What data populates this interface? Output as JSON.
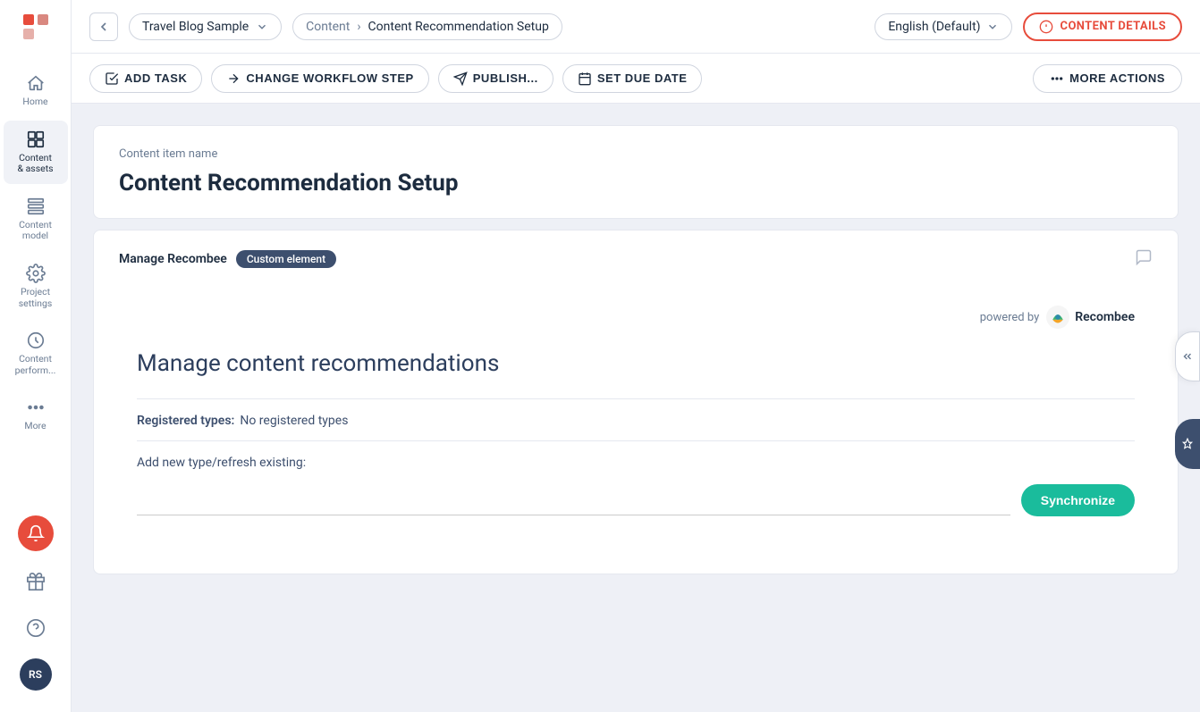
{
  "app": {
    "logo_alt": "Kontent logo"
  },
  "sidebar": {
    "items": [
      {
        "id": "home",
        "label": "Home",
        "active": false
      },
      {
        "id": "content-assets",
        "label": "Content\n& assets",
        "active": true
      },
      {
        "id": "content-model",
        "label": "Content\nmodel",
        "active": false
      },
      {
        "id": "project-settings",
        "label": "Project\nsettings",
        "active": false
      },
      {
        "id": "content-perf",
        "label": "Content\nperform...",
        "active": false
      },
      {
        "id": "more",
        "label": "More",
        "active": false
      }
    ],
    "bottom": {
      "notif_icon": "bell-icon",
      "gift_icon": "gift-icon",
      "help_icon": "help-icon",
      "user_initials": "RS"
    }
  },
  "topbar": {
    "back_label": "back",
    "project_name": "Travel Blog Sample",
    "breadcrumb_sep": "›",
    "section": "Content",
    "page": "Content Recommendation Setup",
    "language": "English (Default)",
    "content_details_label": "CONTENT DETAILS"
  },
  "toolbar": {
    "add_task_label": "ADD TASK",
    "change_workflow_label": "CHANGE WORKFLOW STEP",
    "publish_label": "PUBLISH...",
    "set_due_date_label": "SET DUE DATE",
    "more_actions_label": "MORE ACTIONS"
  },
  "content": {
    "name_label": "Content item name",
    "name_value": "Content Recommendation Setup",
    "element_title": "Manage Recombee",
    "element_badge": "Custom element",
    "manage_title": "Manage content recommendations",
    "powered_by": "powered by",
    "recombee_name": "Recombee",
    "registered_types_label": "Registered types:",
    "registered_types_value": "No registered types",
    "add_new_label": "Add new type/refresh existing:",
    "sync_input_placeholder": "",
    "synchronize_label": "Synchronize"
  }
}
